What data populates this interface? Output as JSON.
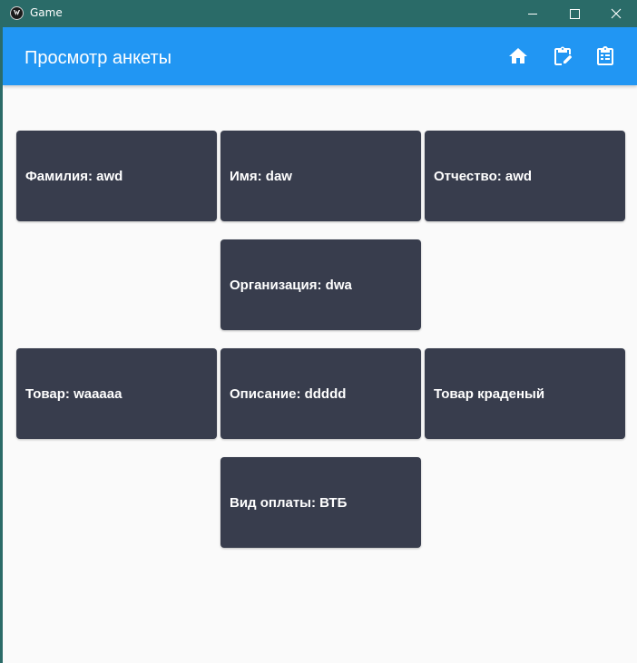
{
  "window": {
    "title": "Game"
  },
  "appbar": {
    "title": "Просмотр анкеты",
    "actions": [
      "home-icon",
      "clipboard-edit-icon",
      "clipboard-list-icon"
    ]
  },
  "cards": [
    "Фамилия: awd",
    "Имя: daw",
    "Отчество: awd",
    "Организация: dwa",
    "Товар: waaaaa",
    "Описание: ddddd",
    "Товар краденый",
    "Вид оплаты: ВТБ"
  ],
  "colors": {
    "titlebar": "#2a6b68",
    "appbar": "#2196f3",
    "card": "#383d4d",
    "background": "#fafafa"
  }
}
